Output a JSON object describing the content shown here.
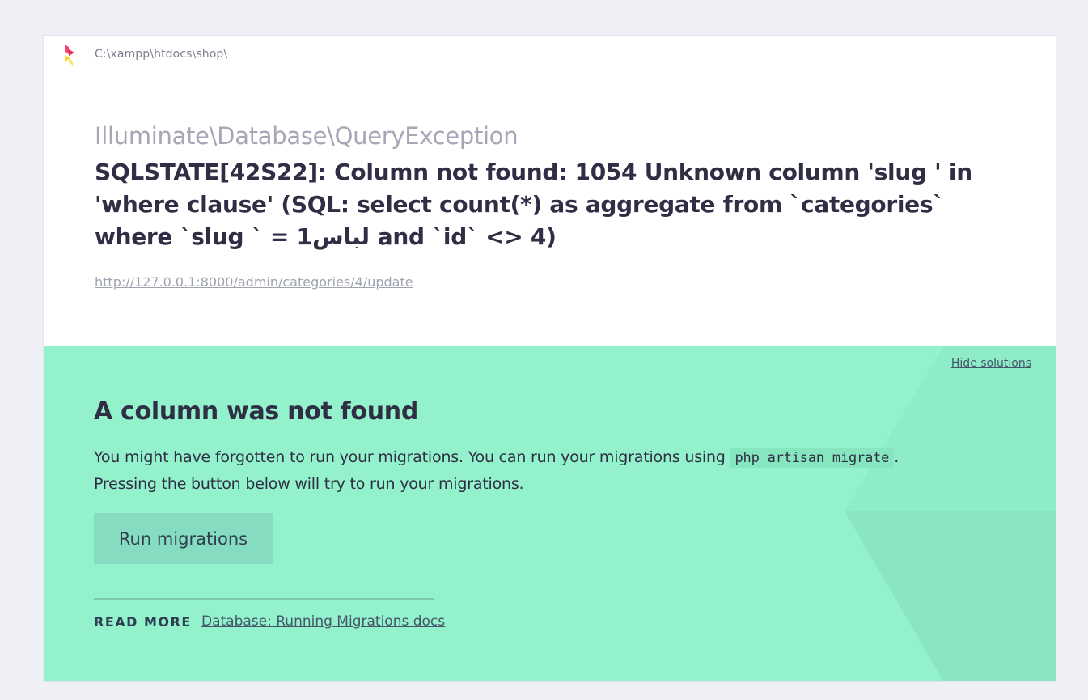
{
  "header": {
    "logo": "ignition-logo-icon",
    "path": "C:\\xampp\\htdocs\\shop\\"
  },
  "exception": {
    "class": "Illuminate\\Database\\QueryException",
    "message": "SQLSTATE[42S22]: Column not found: 1054 Unknown column 'slug ' in 'where clause' (SQL: select count(*) as aggregate from `categories` where `slug ` = لباس1 and `id` <> 4)",
    "url": "http://127.0.0.1:8000/admin/categories/4/update"
  },
  "solution": {
    "hide_label": "Hide solutions",
    "title": "A column was not found",
    "text_before": "You might have forgotten to run your migrations. You can run your migrations using ",
    "code": "php artisan migrate",
    "text_after": ".",
    "text_line2": "Pressing the button below will try to run your migrations.",
    "button_label": "Run migrations",
    "read_more_label": "READ MORE",
    "docs_link_label": "Database: Running Migrations docs"
  },
  "colors": {
    "page_background": "#eef0f5",
    "solution_background": "#93f2cc",
    "button_background": "#86dcc0",
    "text": "#2f2e45"
  }
}
